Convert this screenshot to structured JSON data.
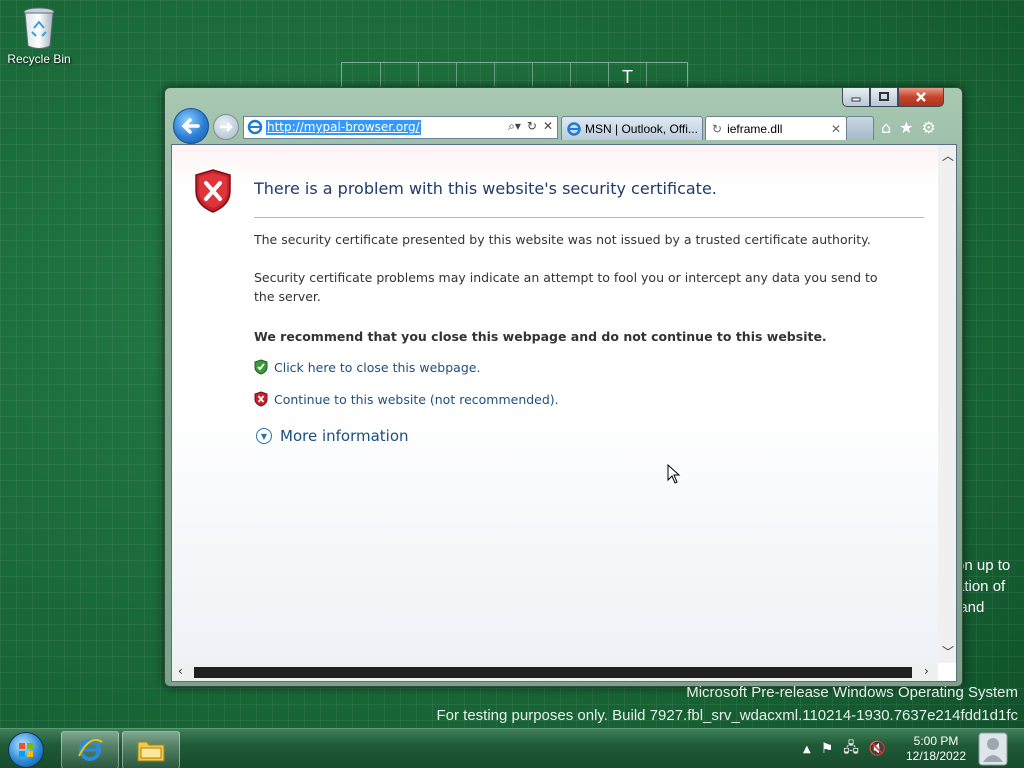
{
  "desktop": {
    "recycle_bin_label": "Recycle Bin",
    "grid_letter": "T",
    "side_text": [
      "on up to",
      "ation of",
      "land"
    ],
    "watermark_line1": "Microsoft Pre-release Windows Operating System",
    "watermark_line2": "For testing purposes only. Build 7927.fbl_srv_wdacxml.110214-1930.7637e214fdd1d1fc"
  },
  "browser": {
    "address": "http://mypal-browser.org/",
    "tabs": [
      {
        "label": "MSN | Outlook, Offi...",
        "icon": "ie-icon"
      },
      {
        "label": "ieframe.dll",
        "icon": "loading-icon"
      }
    ],
    "error_page": {
      "title": "There is a problem with this website's security certificate.",
      "paragraph1": "The security certificate presented by this website was not issued by a trusted certificate authority.",
      "paragraph2": "Security certificate problems may indicate an attempt to fool you or intercept any data you send to the server.",
      "recommendation": "We recommend that you close this webpage and do not continue to this website.",
      "link_close": "Click here to close this webpage.",
      "link_continue": "Continue to this website (not recommended).",
      "more_info": "More information"
    }
  },
  "taskbar": {
    "time": "5:00 PM",
    "date": "12/18/2022"
  },
  "colors": {
    "desktop": "#1b6b3a",
    "title_text": "#1f3a6e",
    "link": "#1c4f80",
    "shield_red": "#c8202c",
    "shield_green": "#3a9a3a"
  }
}
